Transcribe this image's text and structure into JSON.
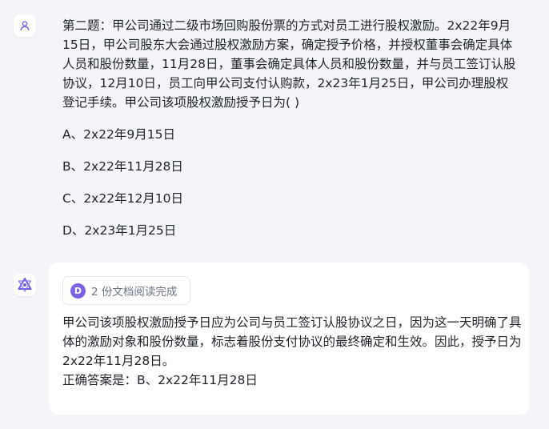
{
  "user_message": {
    "question": "第二题：甲公司通过二级市场回购股份票的方式对员工进行股权激励。2x22年9月15日，甲公司股东大会通过股权激励方案，确定授予价格，并授权董事会确定具体人员和股份数量，11月28日，董事会确定具体人员和股份数量，并与员工签订认股协议，12月10日，员工向甲公司支付认购款，2x23年1月25日，甲公司办理股权登记手续。甲公司该项股权激励授予日为( )",
    "options": [
      "A、2x22年9月15日",
      "B、2x22年11月28日",
      "C、2x22年12月10日",
      "D、2x23年1月25日"
    ]
  },
  "bot_message": {
    "doc_icon_letter": "D",
    "doc_status": "2 份文档阅读完成",
    "answer": "甲公司该项股权激励授予日应为公司与员工签订认股协议之日，因为这一天明确了具体的激励对象和股份数量，标志着股份支付协议的最终确定和生效。因此，授予日为2x22年11月28日。",
    "final_answer": "正确答案是：B、2x22年11月28日"
  },
  "icons": {
    "user_avatar": "user-icon",
    "bot_avatar": "assistant-logo-icon",
    "doc": "document-icon"
  },
  "colors": {
    "background": "#f4f5f8",
    "doc_icon": "#7b61e8",
    "bot_logo": "#6b5ce7"
  }
}
